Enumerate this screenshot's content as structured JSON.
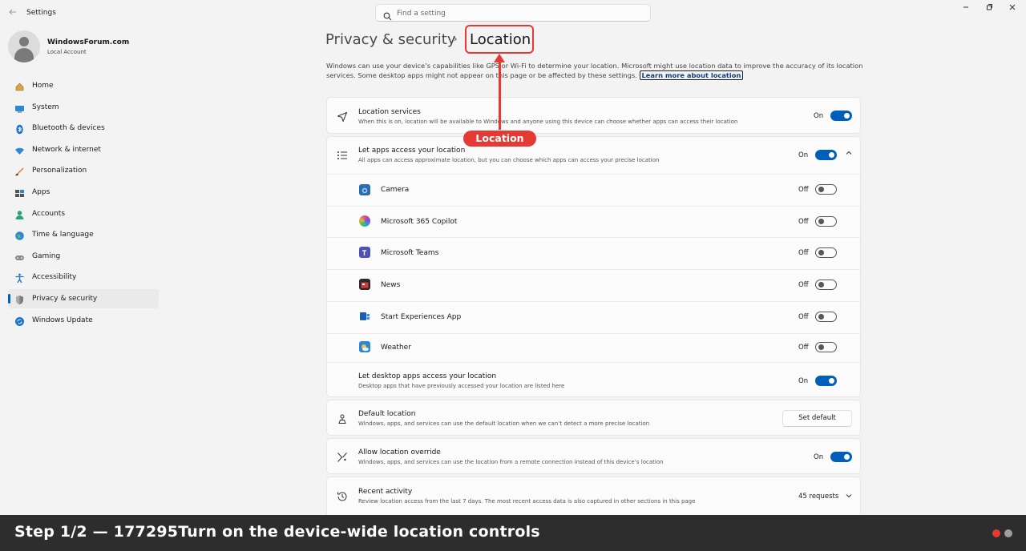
{
  "window": {
    "title": "Settings",
    "back_icon": "back-arrow-icon"
  },
  "search": {
    "placeholder": "Find a setting"
  },
  "account": {
    "name": "WindowsForum.com",
    "type": "Local Account"
  },
  "sidebar": {
    "items": [
      {
        "label": "Home",
        "icon": "home-icon"
      },
      {
        "label": "System",
        "icon": "system-icon"
      },
      {
        "label": "Bluetooth & devices",
        "icon": "bluetooth-icon"
      },
      {
        "label": "Network & internet",
        "icon": "wifi-icon"
      },
      {
        "label": "Personalization",
        "icon": "brush-icon"
      },
      {
        "label": "Apps",
        "icon": "apps-icon"
      },
      {
        "label": "Accounts",
        "icon": "accounts-icon"
      },
      {
        "label": "Time & language",
        "icon": "globe-icon"
      },
      {
        "label": "Gaming",
        "icon": "gamepad-icon"
      },
      {
        "label": "Accessibility",
        "icon": "accessibility-icon"
      },
      {
        "label": "Privacy & security",
        "icon": "shield-icon",
        "active": true
      },
      {
        "label": "Windows Update",
        "icon": "update-icon"
      }
    ]
  },
  "header": {
    "parent": "Privacy & security",
    "separator": "›",
    "current": "Location",
    "description": "Windows can use your device’s capabilities like GPS or Wi-Fi to determine your location. Microsoft might use location data to improve the accuracy of its location services. Some desktop apps might not appear on this page or be affected by these settings.",
    "learn_more": "Learn more about location"
  },
  "location_services": {
    "title": "Location services",
    "subtitle": "When this is on, location will be available to Windows and anyone using this device can choose whether apps can access their location",
    "state": "On"
  },
  "apps_access": {
    "title": "Let apps access your location",
    "subtitle": "All apps can access approximate location, but you can choose which apps can access your precise location",
    "state": "On",
    "apps": [
      {
        "name": "Camera",
        "state": "Off"
      },
      {
        "name": "Microsoft 365 Copilot",
        "state": "Off"
      },
      {
        "name": "Microsoft Teams",
        "state": "Off"
      },
      {
        "name": "News",
        "state": "Off"
      },
      {
        "name": "Start Experiences App",
        "state": "Off"
      },
      {
        "name": "Weather",
        "state": "Off"
      }
    ],
    "desktop": {
      "title": "Let desktop apps access your location",
      "subtitle": "Desktop apps that have previously accessed your location are listed here",
      "state": "On"
    }
  },
  "default_location": {
    "title": "Default location",
    "subtitle": "Windows, apps, and services can use the default location when we can’t detect a more precise location",
    "button": "Set default"
  },
  "override": {
    "title": "Allow location override",
    "subtitle": "Windows, apps, and services can use the location from a remote connection instead of this device’s location",
    "state": "On"
  },
  "recent": {
    "title": "Recent activity",
    "subtitle": "Review location access from the last 7 days. The most recent access data is also captured in other sections in this page",
    "count": "45 requests"
  },
  "annotation": {
    "callout": "Location",
    "color": "#e53935"
  },
  "banner": {
    "text": "Step 1/2 — 177295Turn on the device-wide location controls",
    "dots": [
      "#e53935",
      "#9e9e9e"
    ]
  },
  "colors": {
    "accent": "#005fb8",
    "background": "#f3f3f3",
    "card": "#fbfbfb"
  }
}
